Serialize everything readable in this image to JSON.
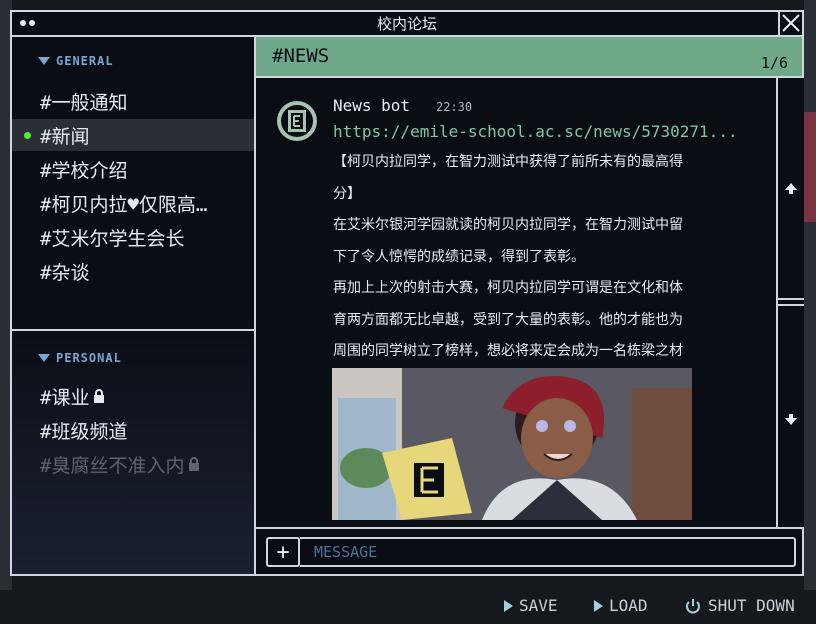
{
  "window": {
    "title": "校内论坛"
  },
  "sidebar": {
    "general": {
      "title": "GENERAL",
      "channels": [
        {
          "label": "#一般通知"
        },
        {
          "label": "#新闻",
          "active": true
        },
        {
          "label": "#学校介绍"
        },
        {
          "label": "#柯贝内拉♥仅限高…"
        },
        {
          "label": "#艾米尔学生会长"
        },
        {
          "label": "#杂谈"
        }
      ]
    },
    "personal": {
      "title": "PERSONAL",
      "channels": [
        {
          "label": "#课业",
          "locked": true
        },
        {
          "label": "#班级频道"
        },
        {
          "label": "#臭腐丝不准入内",
          "locked": true,
          "disabled": true
        }
      ]
    }
  },
  "channel": {
    "name": "#NEWS",
    "page": "1/6"
  },
  "message": {
    "author": "News bot",
    "time": "22:30",
    "link": "https://emile-school.ac.sc/news/5730271...",
    "lines": [
      "【柯贝内拉同学，在智力测试中获得了前所未有的最高得",
      "分】",
      "在艾米尔银河学园就读的柯贝内拉同学，在智力测试中留",
      "下了令人惊愕的成绩记录，得到了表彰。",
      "再加上上次的射击大赛，柯贝内拉同学可谓是在文化和体",
      "育两方面都无比卓越，受到了大量的表彰。他的才能也为",
      "周围的同学树立了榜样，想必将来定会成为一名栋梁之材"
    ]
  },
  "composer": {
    "add_label": "+",
    "placeholder": "MESSAGE"
  },
  "bottom": {
    "save": "SAVE",
    "load": "LOAD",
    "shutdown": "SHUT DOWN"
  },
  "colors": {
    "header": "#6fa98a",
    "link": "#7fc6a6",
    "section": "#7aa6d0",
    "active_dot": "#4cf02e"
  }
}
